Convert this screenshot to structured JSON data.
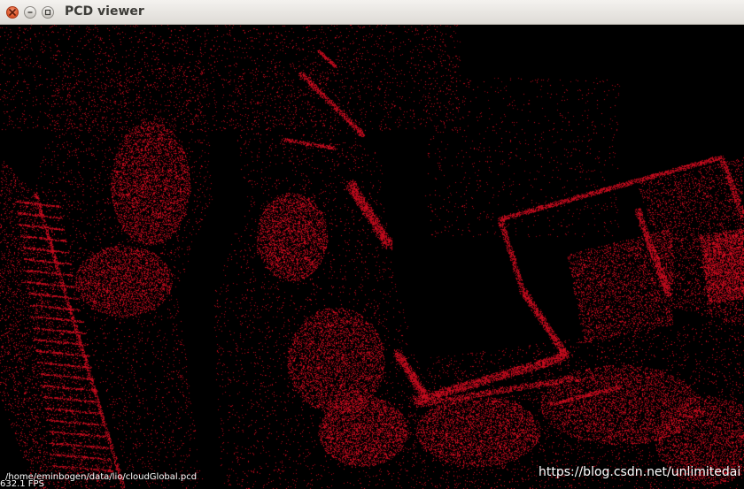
{
  "window": {
    "title": "PCD viewer",
    "controls": [
      "close",
      "minimize",
      "maximize"
    ]
  },
  "viewer": {
    "file_path": "/home/eminbogen/data/lio/cloudGlobal.pcd",
    "fps": "632.1 FPS",
    "point_color": "#c0091a",
    "background_color": "#000000"
  },
  "watermark": {
    "text": "https://blog.csdn.net/unlimitedai"
  }
}
